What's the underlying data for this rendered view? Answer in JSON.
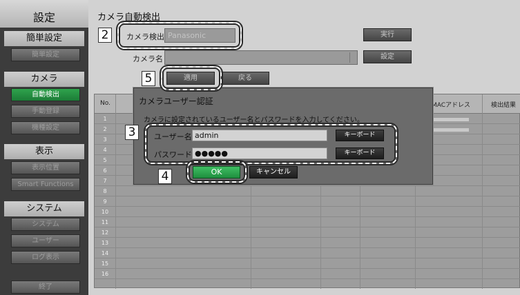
{
  "sidebar": {
    "title": "設定",
    "sections": {
      "simple": "簡単設定",
      "camera": "カメラ",
      "display": "表示",
      "system": "システム"
    },
    "items": {
      "simple_setup": "簡単設定",
      "auto_detect": "自動検出",
      "manual_register": "手動登録",
      "model_settings": "機種設定",
      "display_position": "表示位置",
      "smart_functions": "Smart Functions",
      "system": "システム",
      "user": "ユーザー",
      "log_display": "ログ表示",
      "exit": "終了"
    }
  },
  "main": {
    "title": "カメラ自動検出",
    "camera_detect_label": "カメラ検出",
    "camera_detect_value": "Panasonic",
    "run_button": "実行",
    "camera_name_label": "カメラ名",
    "camera_name_value": "",
    "settings_button": "設定",
    "apply_button": "適用",
    "back_button": "戻る"
  },
  "table": {
    "headers": {
      "no": "No.",
      "mac": "MACアドレス",
      "result": "検出結果"
    },
    "rows": [
      "1",
      "2",
      "3",
      "4",
      "5",
      "6",
      "7",
      "8",
      "9",
      "10",
      "11",
      "12",
      "13",
      "14",
      "15",
      "16"
    ]
  },
  "dialog": {
    "title": "カメラユーザー認証",
    "message": "カメラに設定されているユーザー名とパスワードを入力してください。",
    "username_label": "ユーザー名：",
    "username_value": "admin",
    "password_label": "パスワード：",
    "password_value": "●●●●●",
    "keyboard_button": "キーボード",
    "ok_button": "OK",
    "cancel_button": "キャンセル"
  },
  "callouts": {
    "step2": "2",
    "step3": "3",
    "step4": "4",
    "step5": "5"
  }
}
